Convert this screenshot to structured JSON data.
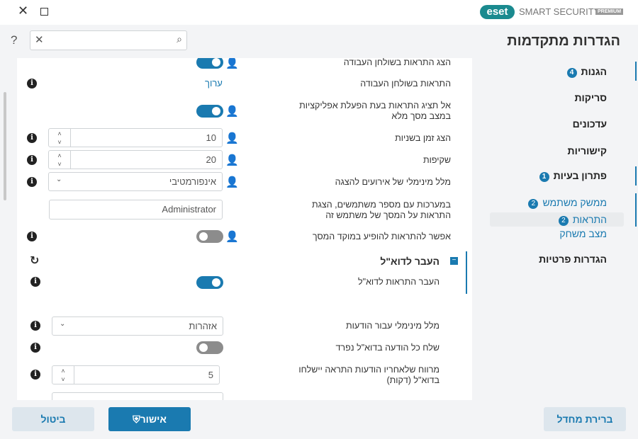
{
  "window": {
    "brand": "eset",
    "product": "SMART SECURITY",
    "edition": "PREMIUM",
    "close_icon": "close-icon",
    "maximize_icon": "maximize-icon"
  },
  "header": {
    "help": "?",
    "search_placeholder": ""
  },
  "sidebar": {
    "title": "הגדרות מתקדמות",
    "items": [
      {
        "label": "הגנות",
        "badge": "4"
      },
      {
        "label": "סריקות"
      },
      {
        "label": "עדכונים"
      },
      {
        "label": "קישוריות"
      },
      {
        "label": "פתרון בעיות",
        "badge": "1"
      },
      {
        "label": "ממשק משתמש",
        "badge": "2"
      },
      {
        "label": "התראות",
        "badge": "2"
      },
      {
        "label": "מצב משחק"
      },
      {
        "label": "הגדרות פרטיות"
      }
    ]
  },
  "settings": {
    "show_desktop_notifications": {
      "label": "הצג התראות בשולחן העבודה",
      "enabled": true
    },
    "desktop_notifications": {
      "label": "התראות בשולחן העבודה",
      "link": "ערוך"
    },
    "no_fullscreen": {
      "label1": "אל תציג התראות בעת הפעלת אפליקציות",
      "label2": "במצב מסך מלא",
      "enabled": true
    },
    "display_time": {
      "label": "הצג זמן בשניות",
      "value": "10"
    },
    "transparency": {
      "label": "שקיפות",
      "value": "20"
    },
    "min_verbosity": {
      "label": "מלל מינימלי של אירועים להצגה",
      "value": "אינפורמטיבי"
    },
    "multiuser": {
      "label1": "במערכות עם מספר משתמשים, הצגת",
      "label2": "התראות על המסך של משתמש זה",
      "value": "Administrator"
    },
    "focus": {
      "label": "אפשר להתראות להופיע במוקד המסך",
      "enabled": false
    }
  },
  "email": {
    "section_title": "העבר לדוא\"ל",
    "forward": {
      "label": "העבר התראות לדוא\"ל",
      "enabled": true
    },
    "min_verbosity": {
      "label": "מלל מינימלי עבור הודעות",
      "value": "אזהרות"
    },
    "separate": {
      "label": "שלח כל הודעה בדוא\"ל נפרד",
      "enabled": false
    },
    "interval": {
      "label1": "מרווח שלאחריו הודעות התראה יישלחו",
      "label2": "בדוא\"ל (דקות)",
      "value": "5"
    }
  },
  "footer": {
    "cancel": "ביטול",
    "ok": "אישור",
    "default": "ברירת מחדל"
  },
  "colors": {
    "accent": "#1a7ab0",
    "background": "#f3f4f6"
  }
}
